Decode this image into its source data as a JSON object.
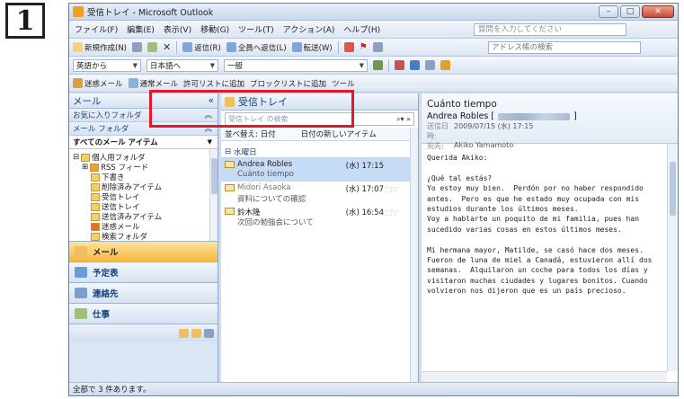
{
  "step_number": "1",
  "window": {
    "title": "受信トレイ - Microsoft Outlook",
    "min": "–",
    "max": "□",
    "close": "✕"
  },
  "menu": {
    "items": [
      "ファイル(F)",
      "編集(E)",
      "表示(V)",
      "移動(G)",
      "ツール(T)",
      "アクション(A)",
      "ヘルプ(H)"
    ],
    "question_placeholder": "質問を入力してください"
  },
  "toolbar1": {
    "new": "新規作成(N)",
    "reply": "返信(R)",
    "reply_all": "全員へ返信(L)",
    "forward": "転送(W)",
    "address_search": "アドレス帳の検索"
  },
  "toolbar2": {
    "from_lang": "英語から",
    "to_lang": "日本語へ",
    "mode": "一般"
  },
  "toolbar3": {
    "junk": "迷惑メール",
    "not_junk": "通常メール",
    "allow": "許可リストに追加",
    "block": "ブロックリストに追加",
    "tools": "ツール"
  },
  "nav": {
    "header": "メール",
    "favorites": "お気に入りフォルダ",
    "mail_folders": "メール フォルダ",
    "all_mail": "すべてのメール アイテム",
    "tree": [
      "個人用フォルダ",
      "RSS フィード",
      "下書き",
      "削除済みアイテム",
      "受信トレイ",
      "送信トレイ",
      "送信済みアイテム",
      "迷惑メール",
      "検索フォルダ"
    ],
    "buttons": [
      "メール",
      "予定表",
      "連絡先",
      "仕事"
    ]
  },
  "list": {
    "header": "受信トレイ",
    "search_placeholder": "受信トレイ の検索",
    "arrange_label": "並べ替え: 日付",
    "arrange_order": "日付の新しいアイテム",
    "group": "水曜日",
    "messages": [
      {
        "from": "Andrea Robles",
        "subject": "Cuánto tiempo",
        "time": "(水) 17:15"
      },
      {
        "from": "Midori Asaoka",
        "subject": "資料についての確認",
        "time": "(水) 17:07"
      },
      {
        "from": "鈴木隆",
        "subject": "次回の勉強会について",
        "time": "(水) 16:54"
      }
    ]
  },
  "reading": {
    "subject": "Cuánto tiempo",
    "from": "Andrea Robles [",
    "from_close": "]",
    "sent_label": "送信日時:",
    "sent": "2009/07/15 (水) 17:15",
    "to_label": "宛先:",
    "to": "Akiko Yamamoto",
    "body": "Querida Akiko:\n\n¿Qué tal estás?\nYo estoy muy bien.  Perdón por no haber respondido antes.  Pero es que he estado muy ocupada con mis estudios durante los últimos meses.\nVoy a hablarte un poquito de mi familia, pues han sucedido varias cosas en estos últimos meses.\n\nMi hermana mayor, Matilde, se casó hace dos meses. Fueron de luna de miel a Canadá, estuvieron allí dos semanas.  Alquilaron un coche para todos los días y visitaron muchas ciudades y lugares bonitos. Cuando volvieron nos dijeron que es un país precioso."
  },
  "status": "全部で 3 件あります。"
}
